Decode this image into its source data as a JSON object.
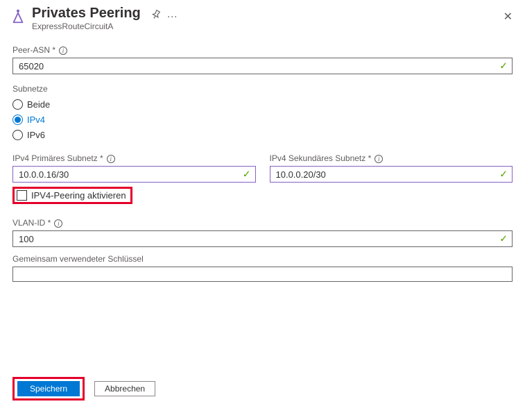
{
  "header": {
    "title": "Privates Peering",
    "subtitle": "ExpressRouteCircuitA"
  },
  "peerAsn": {
    "label": "Peer-ASN",
    "value": "65020"
  },
  "subnets": {
    "label": "Subnetze",
    "options": {
      "both": "Beide",
      "ipv4": "IPv4",
      "ipv6": "IPv6"
    }
  },
  "primary": {
    "label": "IPv4 Primäres Subnetz",
    "value": "10.0.0.16/30"
  },
  "secondary": {
    "label": "IPv4 Sekundäres Subnetz",
    "value": "10.0.0.20/30"
  },
  "enableIpv4": {
    "label": "IPV4-Peering aktivieren"
  },
  "vlan": {
    "label": "VLAN-ID",
    "value": "100"
  },
  "sharedKey": {
    "label": "Gemeinsam verwendeter Schlüssel",
    "value": ""
  },
  "buttons": {
    "save": "Speichern",
    "cancel": "Abbrechen"
  }
}
